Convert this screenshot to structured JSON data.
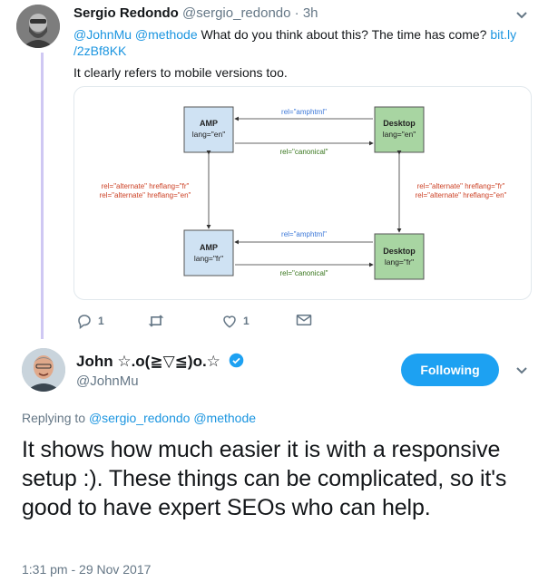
{
  "tweet1": {
    "name": "Sergio Redondo",
    "handle": "@sergio_redondo",
    "dot": "·",
    "time": "3h",
    "mention1": "@JohnMu",
    "mention2": "@methode",
    "text1": " What do you think about this? The time has come? ",
    "link": "bit.ly/2zBf8KK",
    "link_part1": "bit.ly",
    "link_part2": "/2zBf8KK",
    "text2": "It clearly refers to mobile versions too.",
    "reply_count": "1",
    "like_count": "1"
  },
  "diagram": {
    "amp_en_line1": "AMP",
    "amp_en_line2": "lang=\"en\"",
    "desktop_en_line1": "Desktop",
    "desktop_en_line2": "lang=\"en\"",
    "amp_fr_line1": "AMP",
    "amp_fr_line2": "lang=\"fr\"",
    "desktop_fr_line1": "Desktop",
    "desktop_fr_line2": "lang=\"fr\"",
    "amphtml_label": "rel=\"amphtml\"",
    "canonical_label": "rel=\"canonical\"",
    "alt_fr_label": "rel=\"alternate\" hreflang=\"fr\"",
    "alt_en_label": "rel=\"alternate\" hreflang=\"en\"",
    "colors": {
      "amp_fill": "#cfe2f3",
      "desktop_fill": "#a8d5a2",
      "amphtml_text": "#3c78d8",
      "canonical_text": "#38761d",
      "alternate_text": "#cc4125"
    }
  },
  "tweet2": {
    "name": "John ☆.o(≧▽≦)o.☆",
    "handle": "@JohnMu",
    "follow_label": "Following",
    "replying_prefix": "Replying to ",
    "reply_to1": "@sergio_redondo",
    "reply_to2": "@methode",
    "body": "It shows how much easier it is with a responsive setup :). These things can be complicated, so it's good to have expert SEOs who can help.",
    "timestamp": "1:31 pm - 29 Nov 2017"
  },
  "icons": {
    "reply": "reply-icon",
    "retweet": "retweet-icon",
    "like": "heart-icon",
    "dm": "envelope-icon",
    "verified": "verified-badge-icon",
    "more": "chevron-down-icon"
  },
  "colors": {
    "link": "#1b95e0",
    "thread_line": "#cfc8f3",
    "follow_button": "#1da1f2",
    "verified": "#1da1f2",
    "muted": "#657786"
  }
}
